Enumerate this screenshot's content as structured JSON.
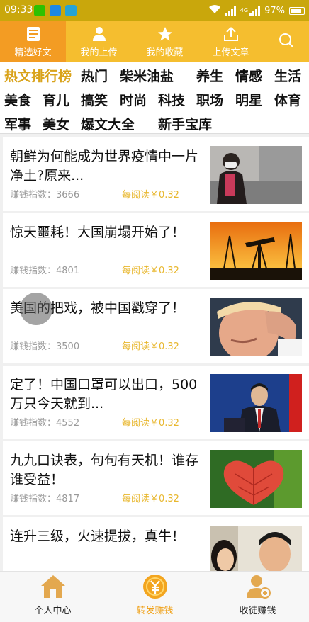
{
  "status_bar": {
    "time": "09:33",
    "network": "4G",
    "battery": "97%",
    "left_icons": [
      "wechat-icon",
      "message-icon",
      "scan-icon"
    ],
    "right_icons": [
      "wifi-icon",
      "signal-icon",
      "signal-4g-icon",
      "battery-icon"
    ]
  },
  "tabs": [
    {
      "label": "精选好文",
      "icon": "article-icon",
      "active": true
    },
    {
      "label": "我的上传",
      "icon": "person-icon",
      "active": false
    },
    {
      "label": "我的收藏",
      "icon": "star-icon",
      "active": false
    },
    {
      "label": "上传文章",
      "icon": "upload-icon",
      "active": false
    }
  ],
  "search_icon": "search-icon",
  "categories": [
    {
      "label": "热文排行榜",
      "highlight": true
    },
    {
      "label": "热门"
    },
    {
      "label": "柴米油盐"
    },
    {
      "label": "养生"
    },
    {
      "label": "情感"
    },
    {
      "label": "生活"
    },
    {
      "label": "美食"
    },
    {
      "label": "育儿"
    },
    {
      "label": "搞笑"
    },
    {
      "label": "时尚"
    },
    {
      "label": "科技"
    },
    {
      "label": "职场"
    },
    {
      "label": "明星"
    },
    {
      "label": "体育"
    },
    {
      "label": "军事"
    },
    {
      "label": "美女"
    },
    {
      "label": "爆文大全"
    },
    {
      "label": "新手宝库"
    }
  ],
  "articles": [
    {
      "title": "朝鲜为何能成为世界疫情中一片净土?原来...",
      "index_text": "赚钱指数：3666",
      "reward_text": "每阅读￥0.32",
      "thumb": "woman-with-mask-photo"
    },
    {
      "title": "惊天噩耗！大国崩塌开始了！",
      "index_text": "赚钱指数：4801",
      "reward_text": "每阅读￥0.32",
      "thumb": "oil-pump-sunset-photo"
    },
    {
      "title": "美国的把戏，被中国戳穿了！",
      "index_text": "赚钱指数：3500",
      "reward_text": "每阅读￥0.32",
      "thumb": "man-hand-on-head-photo"
    },
    {
      "title": "定了！中国口罩可以出口，500万只今天就到...",
      "index_text": "赚钱指数：4552",
      "reward_text": "每阅读￥0.32",
      "thumb": "spokesman-podium-photo"
    },
    {
      "title": "九九口诀表，句句有天机！谁存谁受益！",
      "index_text": "赚钱指数：4817",
      "reward_text": "每阅读￥0.32",
      "thumb": "red-heart-leaf-photo"
    },
    {
      "title": "连升三级，火速提拔，真牛！",
      "index_text": "",
      "reward_text": "",
      "thumb": "two-people-selfie-photo"
    }
  ],
  "bottom_nav": [
    {
      "label": "个人中心",
      "icon": "home-icon",
      "active": false
    },
    {
      "label": "转发赚钱",
      "icon": "coin-icon",
      "active": true
    },
    {
      "label": "收徒赚钱",
      "icon": "recruit-person-icon",
      "active": false
    }
  ],
  "colors": {
    "status_bar": "#c9a70c",
    "tab_bar": "#f5be2f",
    "tab_active": "#f39c23",
    "highlight_category": "#d9a31b",
    "reward": "#e8b72e"
  }
}
